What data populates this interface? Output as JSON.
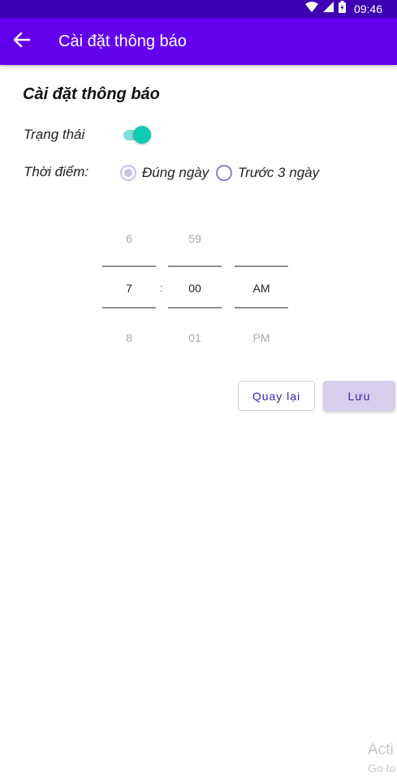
{
  "status_bar": {
    "time": "09:46",
    "icons": [
      "wifi-icon",
      "signal-icon",
      "battery-icon"
    ]
  },
  "app_bar": {
    "back_icon": "arrow-left-icon",
    "title": "Cài đặt thông báo",
    "color": "#6200ee"
  },
  "content": {
    "section_title": "Cài đặt thông báo",
    "status_label": "Trạng thái",
    "status_toggle_on": true,
    "time_label": "Thời điểm:",
    "radio_options": [
      {
        "label": "Đúng ngày",
        "checked": true
      },
      {
        "label": "Trước 3 ngày",
        "checked": false
      }
    ]
  },
  "time_picker": {
    "hour": {
      "prev": "6",
      "selected": "7",
      "next": "8"
    },
    "minute": {
      "prev": "59",
      "selected": "00",
      "next": "01"
    },
    "ampm": {
      "prev": "",
      "selected": "AM",
      "next": "PM"
    },
    "separator": ":"
  },
  "buttons": {
    "back_label": "Quay lại",
    "save_label": "Lưu"
  },
  "watermark": {
    "line1": "Acti",
    "line2": "Go to"
  },
  "colors": {
    "accent": "#6200ee",
    "toggle": "#10c9b3",
    "button_text": "#3a1fb0"
  }
}
